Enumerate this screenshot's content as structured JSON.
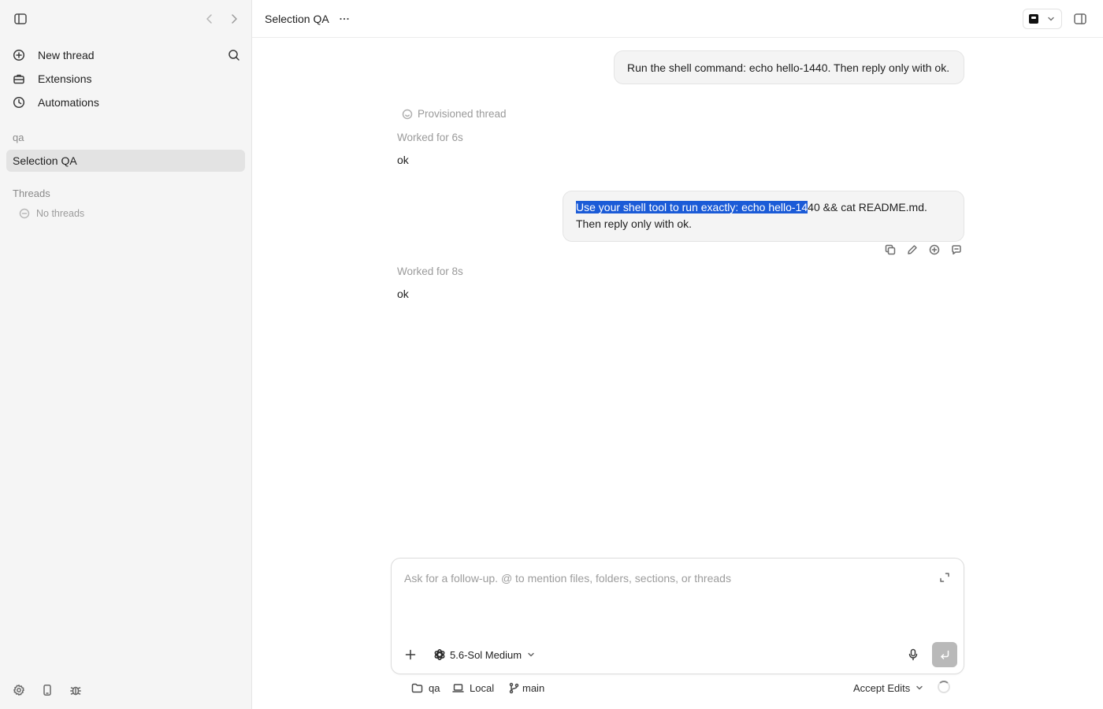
{
  "sidebar": {
    "toggle_icon": "sidebar-toggle-icon",
    "nav": [
      {
        "label": "New thread",
        "icon": "plus-circle-icon"
      },
      {
        "label": "Extensions",
        "icon": "toolbox-icon"
      },
      {
        "label": "Automations",
        "icon": "clock-icon"
      }
    ],
    "project_group_label": "qa",
    "project_item": "Selection QA",
    "threads_label": "Threads",
    "no_threads": "No threads",
    "bottom_icons": [
      "gear-icon",
      "phone-icon",
      "bug-icon"
    ]
  },
  "header": {
    "title": "Selection QA",
    "more_icon": "ellipsis-icon",
    "panel_icon": "right-panel-icon"
  },
  "conversation": {
    "message1": "Run the shell command: echo hello-1440. Then reply only with ok.",
    "provisioned": "Provisioned thread",
    "worked1": "Worked for 6s",
    "reply1": "ok",
    "message2_selected": "Use your shell tool to run exactly: echo hello-14",
    "message2_rest_line1": "40 && cat README.md.",
    "message2_line2": "Then reply only with ok.",
    "message_action_icons": [
      "copy-icon",
      "edit-icon",
      "add-comment-icon",
      "fork-icon"
    ],
    "worked2": "Worked for 8s",
    "reply2": "ok"
  },
  "composer": {
    "placeholder": "Ask for a follow-up. @ to mention files, folders, sections, or threads",
    "value": "",
    "model": "5.6-Sol Medium",
    "send_color": "#b9b9b9"
  },
  "footer": {
    "folder": "qa",
    "environment": "Local",
    "branch": "main",
    "mode": "Accept Edits"
  },
  "colors": {
    "selection": "#1b5bd7",
    "sidebar_bg": "#f5f5f5",
    "active_item_bg": "#e3e3e3"
  }
}
